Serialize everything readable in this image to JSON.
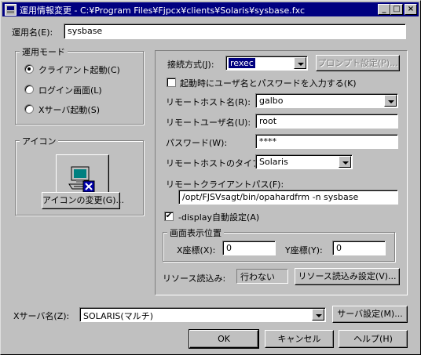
{
  "window": {
    "title": "運用情報変更 - C:¥Program Files¥Fjpcx¥clients¥Solaris¥sysbase.fxc",
    "minimize": "_",
    "maximize": "□",
    "close": "×"
  },
  "op_name": {
    "label": "運用名(E):",
    "value": "sysbase"
  },
  "mode": {
    "title": "運用モード",
    "options": [
      "クライアント起動(C)",
      "ログイン画面(L)",
      "Xサーバ起動(S)"
    ],
    "selected": "クライアント起動(C)"
  },
  "icon_group": {
    "title": "アイコン",
    "change_button": "アイコンの変更(G)..."
  },
  "conn": {
    "method_label": "接続方式(J):",
    "method_value": "rexec",
    "prompt_button": "プロンプト設定(P)...",
    "input_at_start": "起動時にユーザ名とパスワードを入力する(K)",
    "remote_host_label": "リモートホスト名(R):",
    "remote_host_value": "galbo",
    "remote_user_label": "リモートユーザ名(U):",
    "remote_user_value": "root",
    "password_label": "パスワード(W):",
    "password_value": "****",
    "host_type_label": "リモートホストのタイプ(T):",
    "host_type_value": "Solaris",
    "client_path_label": "リモートクライアントパス(F):",
    "client_path_value": "/opt/FJSVsagt/bin/opahardfrm -n sysbase",
    "display_auto": "-display自動設定(A)",
    "display_checked": "✔"
  },
  "position": {
    "title": "画面表示位置",
    "x_label": "X座標(X):",
    "x_value": "0",
    "y_label": "Y座標(Y):",
    "y_value": "0"
  },
  "resource": {
    "label": "リソース読込み:",
    "value": "行わない",
    "button": "リソース読込み設定(V)..."
  },
  "xserver": {
    "label": "Xサーバ名(Z):",
    "value": "SOLARIS(マルチ)",
    "button": "サーバ設定(M)..."
  },
  "buttons": {
    "ok": "OK",
    "cancel": "キャンセル",
    "help": "ヘルプ(H)"
  }
}
